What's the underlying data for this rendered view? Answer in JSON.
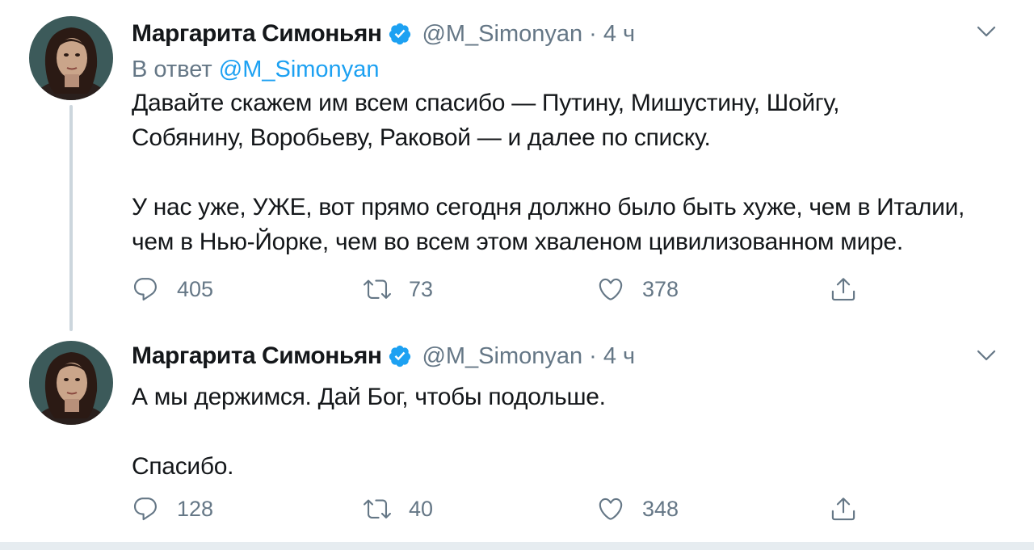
{
  "colors": {
    "accent": "#1da1f2",
    "secondary_text": "#657786",
    "primary_text": "#14171a",
    "thread_line": "#ccd6dd"
  },
  "tweets": [
    {
      "display_name": "Маргарита Симоньян",
      "verified_icon": "verified-badge-icon",
      "handle": "@M_Simonyan",
      "separator": "·",
      "time": "4 ч",
      "reply_prefix": "В ответ",
      "reply_handle": "@M_Simonyan",
      "lines": [
        "Давайте скажем им всем спасибо — Путину, Мишустину, Шойгу,",
        "Собянину, Воробьеву, Раковой — и далее по списку.",
        "У нас уже, УЖЕ, вот прямо сегодня должно было быть хуже, чем в Италии,",
        "чем в Нью-Йорке, чем во всем этом хваленом цивилизованном мире."
      ],
      "replies": "405",
      "retweets": "73",
      "likes": "378"
    },
    {
      "display_name": "Маргарита Симоньян",
      "verified_icon": "verified-badge-icon",
      "handle": "@M_Simonyan",
      "separator": "·",
      "time": "4 ч",
      "lines": [
        "А мы держимся. Дай Бог, чтобы подольше.",
        "Спасибо."
      ],
      "replies": "128",
      "retweets": "40",
      "likes": "348"
    }
  ]
}
